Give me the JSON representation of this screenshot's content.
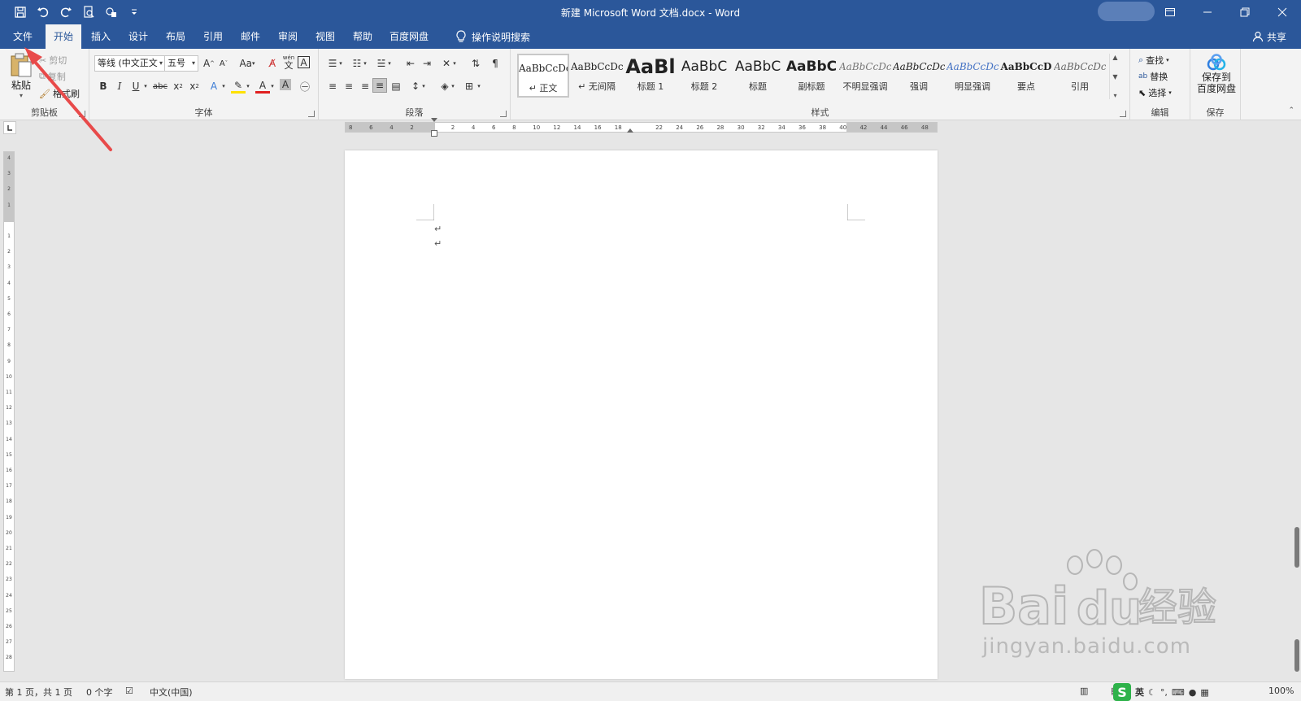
{
  "title_bar": {
    "document_title": "新建 Microsoft Word 文档.docx  -  Word",
    "qat_icons": [
      "save-icon",
      "undo-icon",
      "redo-icon",
      "print-preview-icon",
      "touch-mode-icon",
      "customize-icon"
    ]
  },
  "tabs": [
    {
      "label": "文件",
      "active": false
    },
    {
      "label": "开始",
      "active": true
    },
    {
      "label": "插入",
      "active": false
    },
    {
      "label": "设计",
      "active": false
    },
    {
      "label": "布局",
      "active": false
    },
    {
      "label": "引用",
      "active": false
    },
    {
      "label": "邮件",
      "active": false
    },
    {
      "label": "审阅",
      "active": false
    },
    {
      "label": "视图",
      "active": false
    },
    {
      "label": "帮助",
      "active": false
    },
    {
      "label": "百度网盘",
      "active": false
    }
  ],
  "tell_me": "操作说明搜索",
  "share": "共享",
  "ribbon": {
    "clipboard": {
      "label": "剪贴板",
      "paste": "粘贴",
      "cut": "剪切",
      "copy": "复制",
      "format_painter": "格式刷"
    },
    "font": {
      "label": "字体",
      "font_name": "等线 (中文正文",
      "font_size": "五号",
      "change_case": "Aa",
      "phonetic": "wén",
      "phonetic_char": "文"
    },
    "paragraph": {
      "label": "段落"
    },
    "styles": {
      "label": "样式",
      "items": [
        {
          "sample": "AaBbCcDc",
          "name": "↵ 正文",
          "selected": true
        },
        {
          "sample": "AaBbCcDc",
          "name": "↵ 无间隔",
          "selected": false
        },
        {
          "sample": "AaBl",
          "name": "标题 1",
          "selected": false
        },
        {
          "sample": "AaBbC",
          "name": "标题 2",
          "selected": false
        },
        {
          "sample": "AaBbC",
          "name": "标题",
          "selected": false
        },
        {
          "sample": "AaBbC",
          "name": "副标题",
          "selected": false
        },
        {
          "sample": "AaBbCcDc",
          "name": "不明显强调",
          "selected": false
        },
        {
          "sample": "AaBbCcDc",
          "name": "强调",
          "selected": false
        },
        {
          "sample": "AaBbCcDc",
          "name": "明显强调",
          "selected": false
        },
        {
          "sample": "AaBbCcD",
          "name": "要点",
          "selected": false
        },
        {
          "sample": "AaBbCcDc",
          "name": "引用",
          "selected": false
        }
      ]
    },
    "editing": {
      "label": "编辑",
      "find": "查找",
      "replace": "替换",
      "select": "选择"
    },
    "save": {
      "label": "保存",
      "button_line1": "保存到",
      "button_line2": "百度网盘"
    }
  },
  "ruler": {
    "h_labels": [
      "8",
      "6",
      "4",
      "2",
      "",
      "2",
      "4",
      "6",
      "8",
      "10",
      "12",
      "14",
      "16",
      "18",
      "",
      "22",
      "24",
      "26",
      "28",
      "30",
      "32",
      "34",
      "36",
      "38",
      "40",
      "42",
      "44",
      "46",
      "48"
    ],
    "v_labels": [
      "4",
      "3",
      "2",
      "1",
      "",
      "1",
      "2",
      "3",
      "4",
      "5",
      "6",
      "7",
      "8",
      "9",
      "10",
      "11",
      "12",
      "13",
      "14",
      "15",
      "16",
      "17",
      "18",
      "19",
      "20",
      "21",
      "22",
      "23",
      "24",
      "25",
      "26",
      "27",
      "28"
    ]
  },
  "page": {
    "paragraph_marks": [
      "↵",
      "↵"
    ]
  },
  "status_bar": {
    "page_info": "第 1 页，共 1 页",
    "word_count": "0 个字",
    "language": "中文(中国)",
    "zoom": "100%",
    "ime_label": "英"
  },
  "watermark": {
    "text": "jingyan.baidu.com"
  },
  "colors": {
    "titlebar": "#2b579a",
    "ribbon": "#f3f3f3",
    "annotation_arrow": "#e84a4a"
  }
}
